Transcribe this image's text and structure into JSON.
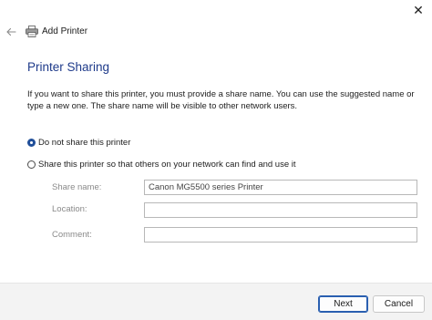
{
  "window": {
    "title": "Add Printer",
    "close_glyph": "✕",
    "back_icon": "back-arrow-icon",
    "printer_icon": "printer-icon"
  },
  "content": {
    "heading": "Printer Sharing",
    "description": "If you want to share this printer, you must provide a share name. You can use the suggested name or type a new one. The share name will be visible to other network users.",
    "options": [
      {
        "label": "Do not share this printer",
        "selected": true
      },
      {
        "label": "Share this printer so that others on your network can find and use it",
        "selected": false
      }
    ],
    "fields": {
      "share_name": {
        "label": "Share name:",
        "value": "Canon MG5500 series Printer"
      },
      "location": {
        "label": "Location:",
        "value": ""
      },
      "comment": {
        "label": "Comment:",
        "value": ""
      }
    }
  },
  "footer": {
    "next_label": "Next",
    "cancel_label": "Cancel"
  },
  "colors": {
    "heading": "#1e3a8a",
    "accent": "#1f4e99"
  }
}
